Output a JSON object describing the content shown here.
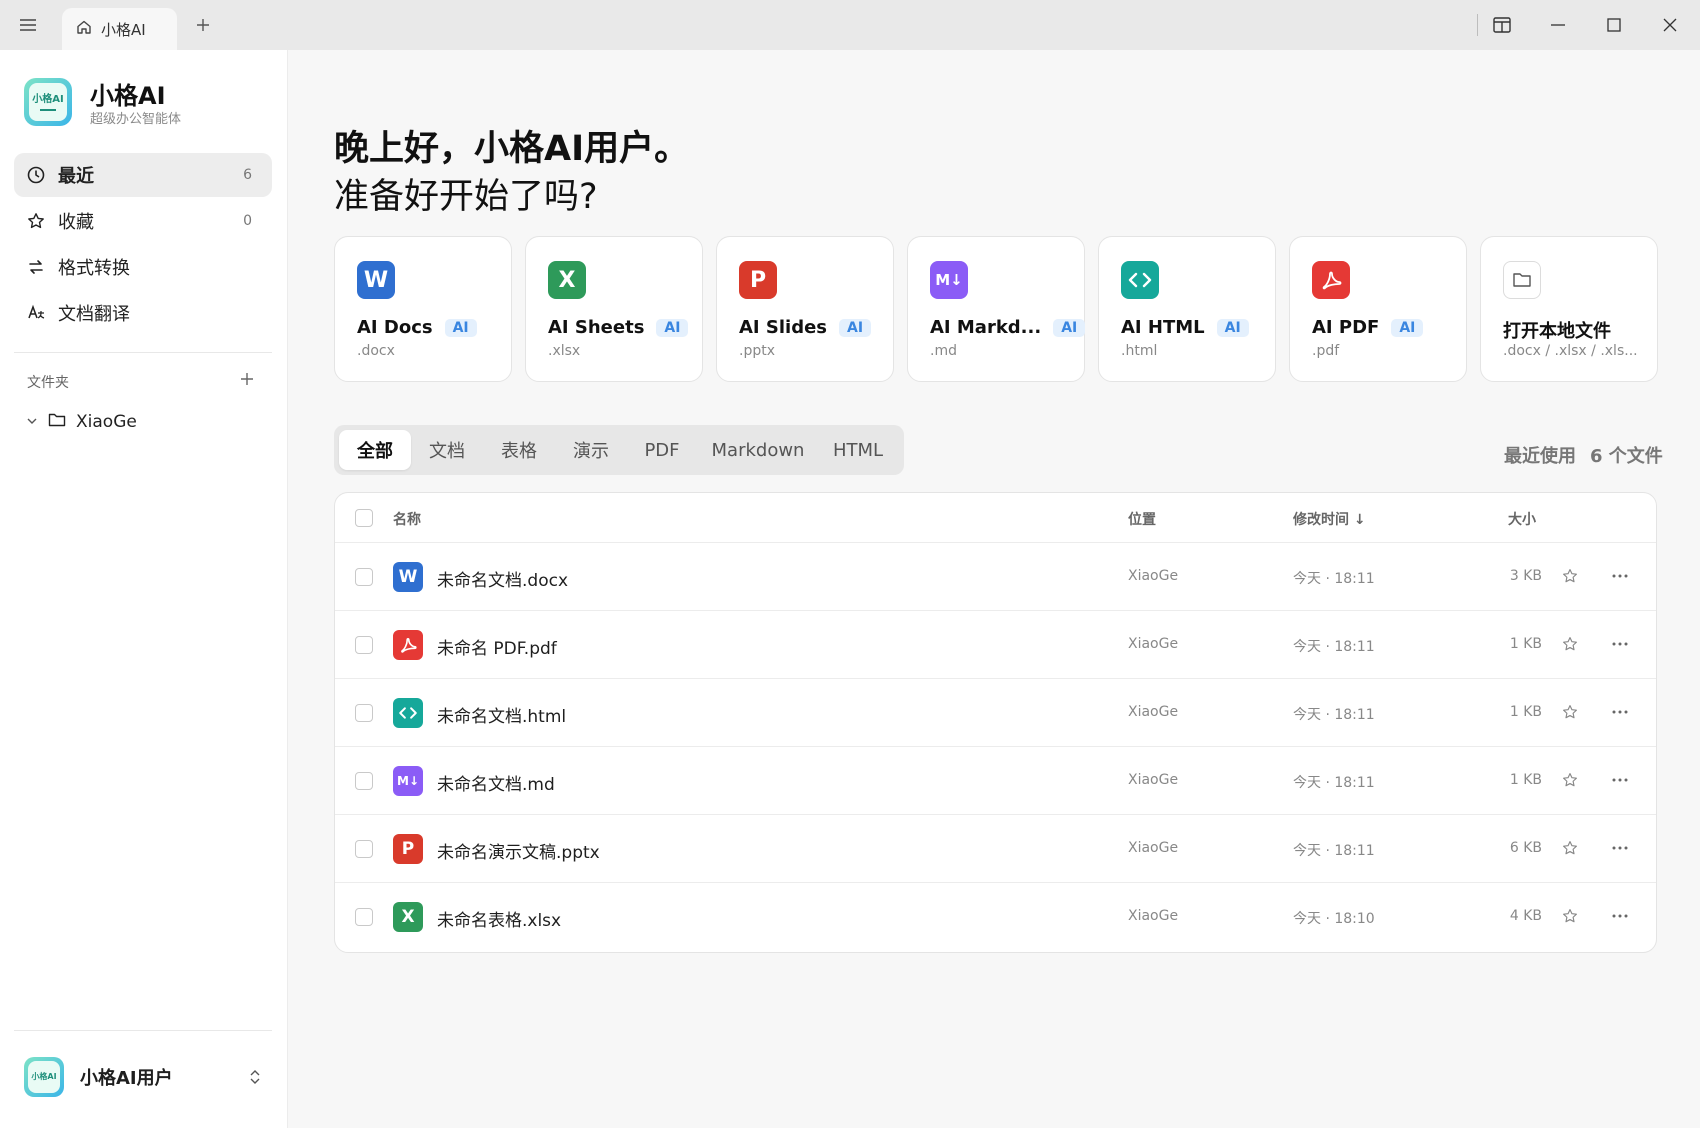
{
  "titlebar": {
    "tab_label": "小格AI"
  },
  "sidebar": {
    "brand_name": "小格AI",
    "brand_sub": "超级办公智能体",
    "logo_text": "小格AI",
    "nav": [
      {
        "label": "最近",
        "count": "6"
      },
      {
        "label": "收藏",
        "count": "0"
      },
      {
        "label": "格式转换"
      },
      {
        "label": "文档翻译"
      }
    ],
    "folders_label": "文件夹",
    "folder_name": "XiaoGe",
    "user_name": "小格AI用户"
  },
  "main": {
    "greeting": "晚上好，小格AI用户。",
    "subgreeting": "准备好开始了吗?",
    "cards": [
      {
        "title": "AI Docs",
        "badge": "AI",
        "ext": ".docx",
        "glyph": "W",
        "color": "#2f6fd0"
      },
      {
        "title": "AI Sheets",
        "badge": "AI",
        "ext": ".xlsx",
        "glyph": "X",
        "color": "#2e9a5a"
      },
      {
        "title": "AI Slides",
        "badge": "AI",
        "ext": ".pptx",
        "glyph": "P",
        "color": "#d93a2b"
      },
      {
        "title": "AI Markd...",
        "badge": "AI",
        "ext": ".md",
        "glyph": "M↓",
        "color": "#8b5cf6"
      },
      {
        "title": "AI HTML",
        "badge": "AI",
        "ext": ".html",
        "glyph": "<>",
        "color": "#16a89a"
      },
      {
        "title": "AI PDF",
        "badge": "AI",
        "ext": ".pdf",
        "glyph": "pdf",
        "color": "#e53935"
      },
      {
        "title": "打开本地文件",
        "ext": ".docx / .xlsx / .xls..."
      }
    ],
    "filter_tabs": [
      "全部",
      "文档",
      "表格",
      "演示",
      "PDF",
      "Markdown",
      "HTML"
    ],
    "recent_label": "最近使用",
    "recent_count": "6 个文件",
    "table": {
      "headers": {
        "name": "名称",
        "location": "位置",
        "modified": "修改时间 ↓",
        "size": "大小"
      },
      "rows": [
        {
          "name": "未命名文档.docx",
          "location": "XiaoGe",
          "time": "今天 · 18:11",
          "size": "3 KB",
          "type": "docx"
        },
        {
          "name": "未命名 PDF.pdf",
          "location": "XiaoGe",
          "time": "今天 · 18:11",
          "size": "1 KB",
          "type": "pdf"
        },
        {
          "name": "未命名文档.html",
          "location": "XiaoGe",
          "time": "今天 · 18:11",
          "size": "1 KB",
          "type": "html"
        },
        {
          "name": "未命名文档.md",
          "location": "XiaoGe",
          "time": "今天 · 18:11",
          "size": "1 KB",
          "type": "md"
        },
        {
          "name": "未命名演示文稿.pptx",
          "location": "XiaoGe",
          "time": "今天 · 18:11",
          "size": "6 KB",
          "type": "pptx"
        },
        {
          "name": "未命名表格.xlsx",
          "location": "XiaoGe",
          "time": "今天 · 18:10",
          "size": "4 KB",
          "type": "xlsx"
        }
      ]
    }
  }
}
